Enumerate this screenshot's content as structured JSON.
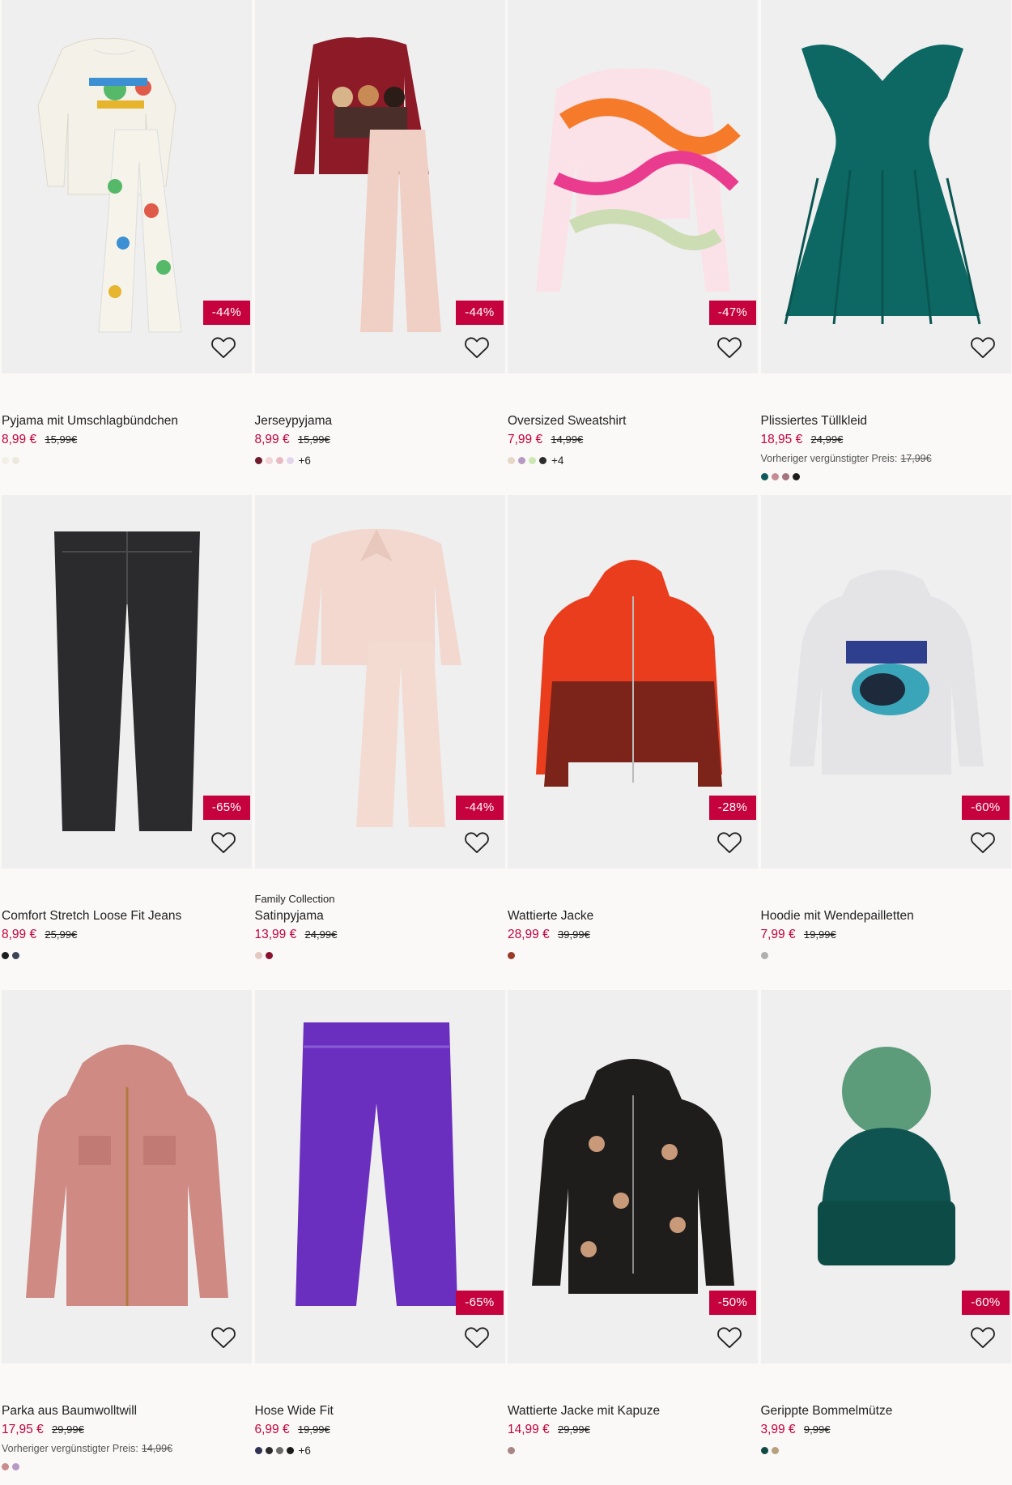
{
  "products": [
    {
      "name": "Pyjama mit Umschlagbündchen",
      "price": "8,99 €",
      "old_price": "15,99€",
      "discount": "-44%",
      "swatches": [
        "#f1efe6",
        "#ece9dc"
      ],
      "more": "",
      "collection": "",
      "prev_label": "",
      "prev_price": "",
      "image": "pyjama-white"
    },
    {
      "name": "Jerseypyjama",
      "price": "8,99 €",
      "old_price": "15,99€",
      "discount": "-44%",
      "swatches": [
        "#6e1b2c",
        "#f2d3d6",
        "#e8b9c3",
        "#e3d6ec"
      ],
      "more": "+6",
      "collection": "",
      "prev_label": "",
      "prev_price": "",
      "image": "pyjama-red"
    },
    {
      "name": "Oversized Sweatshirt",
      "price": "7,99 €",
      "old_price": "14,99€",
      "discount": "-47%",
      "swatches": [
        "#e7d7c6",
        "#b79ac3",
        "#cde7b2",
        "#2c2c2c"
      ],
      "more": "+4",
      "collection": "",
      "prev_label": "",
      "prev_price": "",
      "image": "sweatshirt"
    },
    {
      "name": "Plissiertes Tüllkleid",
      "price": "18,95 €",
      "old_price": "24,99€",
      "discount": "",
      "swatches": [
        "#0e5a5a",
        "#c48d94",
        "#a7737f",
        "#1c1c1c"
      ],
      "more": "",
      "collection": "",
      "prev_label": "Vorheriger vergünstigter Preis:",
      "prev_price": "17,99€",
      "image": "dress"
    },
    {
      "name": "Comfort Stretch Loose Fit Jeans",
      "price": "8,99 €",
      "old_price": "25,99€",
      "discount": "-65%",
      "swatches": [
        "#1d1d1d",
        "#3a4456"
      ],
      "more": "",
      "collection": "",
      "prev_label": "",
      "prev_price": "",
      "image": "jeans"
    },
    {
      "name": "Satinpyjama",
      "price": "13,99 €",
      "old_price": "24,99€",
      "discount": "-44%",
      "swatches": [
        "#e3c9c0",
        "#8a1230"
      ],
      "more": "",
      "collection": "Family Collection",
      "prev_label": "",
      "prev_price": "",
      "image": "satin"
    },
    {
      "name": "Wattierte Jacke",
      "price": "28,99 €",
      "old_price": "39,99€",
      "discount": "-28%",
      "swatches": [
        "#9a3a28"
      ],
      "more": "",
      "collection": "",
      "prev_label": "",
      "prev_price": "",
      "image": "jacket-red"
    },
    {
      "name": "Hoodie mit Wendepailletten",
      "price": "7,99 €",
      "old_price": "19,99€",
      "discount": "-60%",
      "swatches": [
        "#b0b0b0"
      ],
      "more": "",
      "collection": "",
      "prev_label": "",
      "prev_price": "",
      "image": "hoodie"
    },
    {
      "name": "Parka aus Baumwolltwill",
      "price": "17,95 €",
      "old_price": "29,99€",
      "discount": "",
      "swatches": [
        "#c98c8a",
        "#b79ac3"
      ],
      "more": "",
      "collection": "",
      "prev_label": "Vorheriger vergünstigter Preis:",
      "prev_price": "14,99€",
      "image": "parka"
    },
    {
      "name": "Hose Wide Fit",
      "price": "6,99 €",
      "old_price": "19,99€",
      "discount": "-65%",
      "swatches": [
        "#2f3354",
        "#2a2a2a",
        "#6a6a6a",
        "#1c1c1c"
      ],
      "more": "+6",
      "collection": "",
      "prev_label": "",
      "prev_price": "",
      "image": "trousers"
    },
    {
      "name": "Wattierte Jacke mit Kapuze",
      "price": "14,99 €",
      "old_price": "29,99€",
      "discount": "-50%",
      "swatches": [
        "#a88683"
      ],
      "more": "",
      "collection": "",
      "prev_label": "",
      "prev_price": "",
      "image": "jacket-black"
    },
    {
      "name": "Gerippte Bommelmütze",
      "price": "3,99 €",
      "old_price": "9,99€",
      "discount": "-60%",
      "swatches": [
        "#124a46",
        "#b8a07e"
      ],
      "more": "",
      "collection": "",
      "prev_label": "",
      "prev_price": "",
      "image": "beanie"
    }
  ]
}
